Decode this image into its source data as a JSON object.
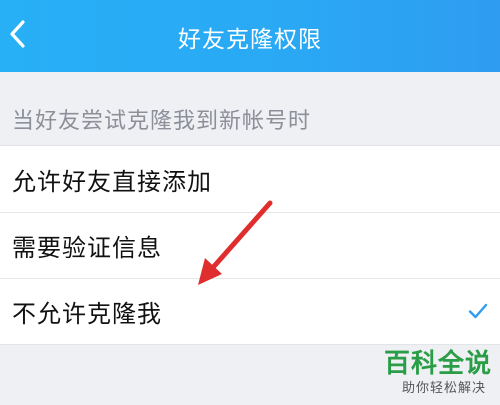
{
  "header": {
    "title": "好友克隆权限",
    "back_icon": "chevron-left-icon"
  },
  "section": {
    "header": "当好友尝试克隆我到新帐号时"
  },
  "options": [
    {
      "label": "允许好友直接添加",
      "selected": false
    },
    {
      "label": "需要验证信息",
      "selected": false
    },
    {
      "label": "不允许克隆我",
      "selected": true
    }
  ],
  "colors": {
    "header_bg": "#2aa8f4",
    "accent": "#2f9cf1",
    "annotation_arrow": "#e02e2e",
    "watermark_green": "#2a9d47"
  },
  "watermark": {
    "title": "百科全说",
    "subtitle": "助你轻松解决"
  }
}
